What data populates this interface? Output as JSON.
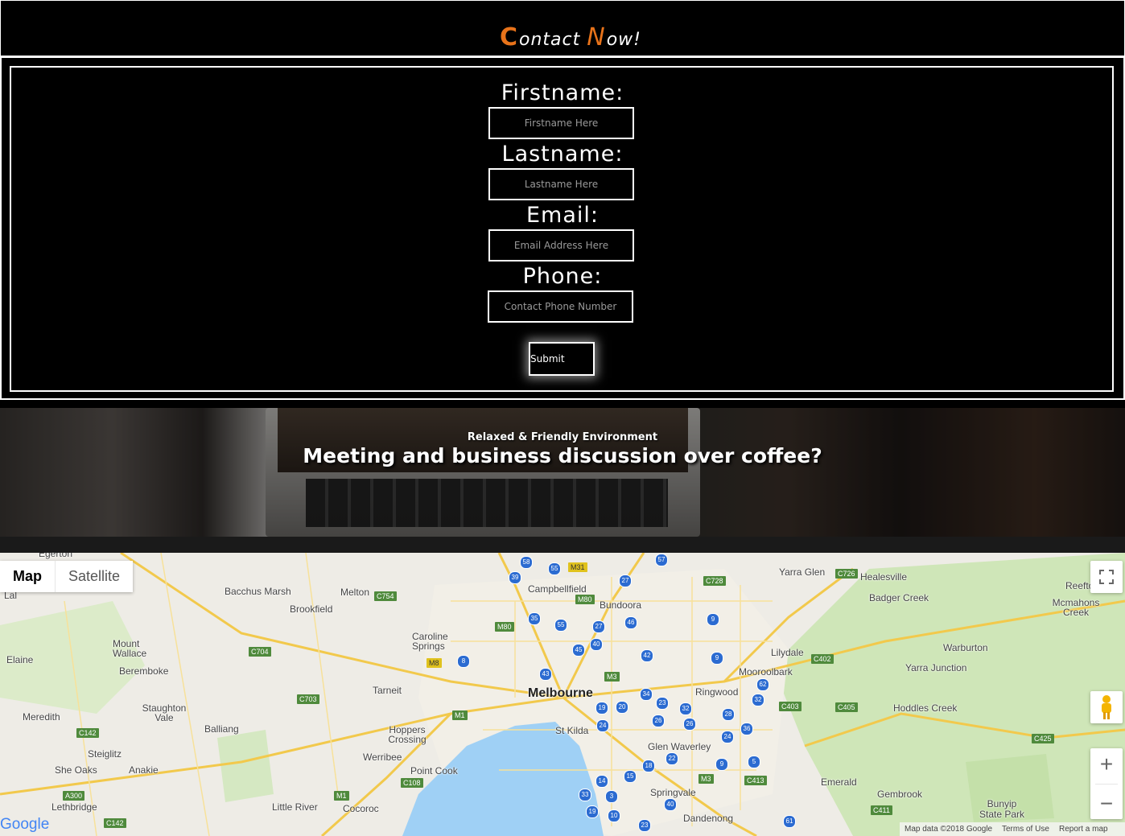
{
  "header": {
    "logo_cap1": "C",
    "logo_rest1": "ontact",
    "logo_cap2": "N",
    "logo_rest2": "ow!"
  },
  "form": {
    "firstname_label": "Firstname:",
    "firstname_placeholder": "Firstname Here",
    "lastname_label": "Lastname:",
    "lastname_placeholder": "Lastname Here",
    "email_label": "Email:",
    "email_placeholder": "Email Address Here",
    "phone_label": "Phone:",
    "phone_placeholder": "Contact Phone Number",
    "submit_label": "Submit"
  },
  "banner": {
    "subtitle": "Relaxed & Friendly Environment",
    "title": "Meeting and business discussion over coffee?"
  },
  "map": {
    "type_map": "Map",
    "type_satellite": "Satellite",
    "zoom_in": "+",
    "zoom_out": "−",
    "logo": "Google",
    "attribution_data": "Map data ©2018 Google",
    "attribution_terms": "Terms of Use",
    "attribution_report": "Report a map error",
    "places": [
      "Melbourne",
      "Bacchus Marsh",
      "Melton",
      "Brookfield",
      "Campbellfield",
      "Bundoora",
      "Yarra Glen",
      "Healesville",
      "Badger Creek",
      "Reefton",
      "Mcmahons Creek",
      "Mount Wallace",
      "Elaine",
      "Beremboke",
      "Caroline Springs",
      "Lilydale",
      "Warburton",
      "Mooroolbark",
      "Yarra Junction",
      "Tarneit",
      "Ringwood",
      "Staughton Vale",
      "Meredith",
      "Balliang",
      "Hoppers Crossing",
      "St Kilda",
      "Hoddles Creek",
      "Steiglitz",
      "Werribee",
      "Glen Waverley",
      "She Oaks",
      "Anakie",
      "Point Cook",
      "Emerald",
      "Lethbridge",
      "Little River",
      "Cocoroc",
      "Springvale",
      "Gembrook",
      "Bunyip State Park",
      "Dandenong",
      "Lal",
      "Egerton"
    ],
    "colors": {
      "water": "#9fd0f5",
      "land": "#eeece6",
      "park": "#c8e3b0",
      "road": "#f5d163"
    }
  },
  "colors": {
    "accent": "#e8731a",
    "background": "#000000",
    "border": "#ffffff"
  }
}
